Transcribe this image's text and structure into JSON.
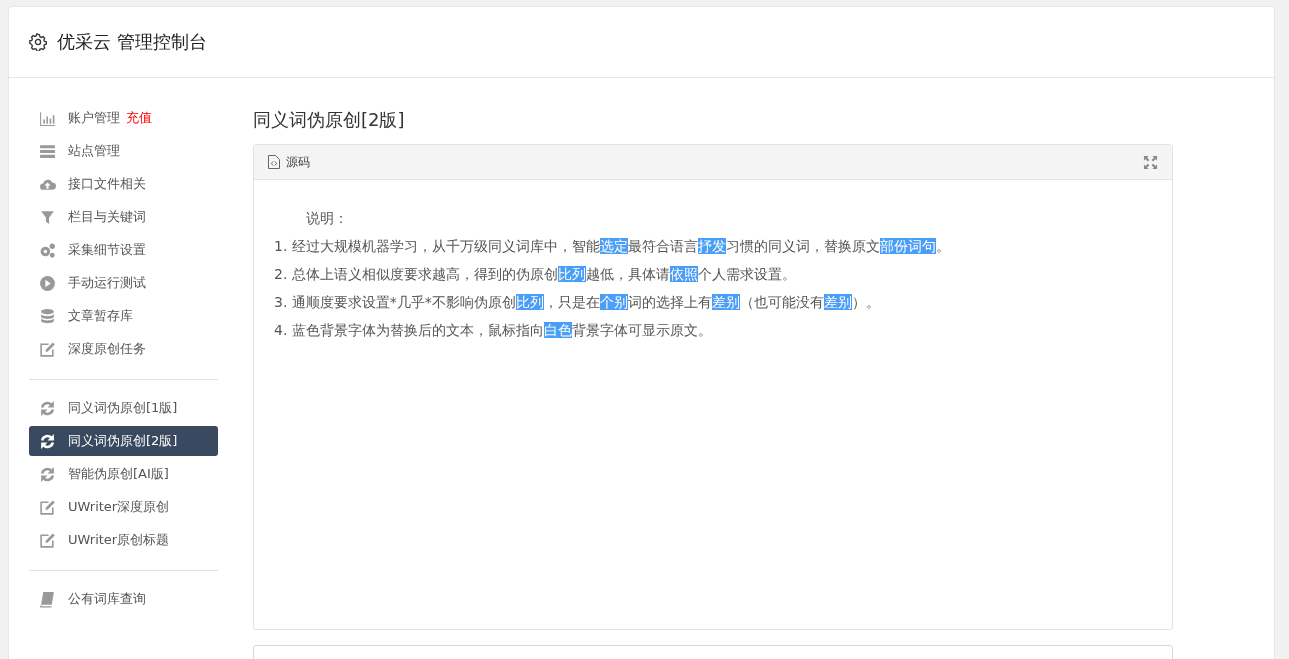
{
  "header": {
    "title": "优采云 管理控制台"
  },
  "sidebar": {
    "groups": [
      {
        "items": [
          {
            "label": "账户管理",
            "badge": "充值",
            "selected": false
          },
          {
            "label": "站点管理",
            "selected": false
          },
          {
            "label": "接口文件相关",
            "selected": false
          },
          {
            "label": "栏目与关键词",
            "selected": false
          },
          {
            "label": "采集细节设置",
            "selected": false
          },
          {
            "label": "手动运行测试",
            "selected": false
          },
          {
            "label": "文章暂存库",
            "selected": false
          },
          {
            "label": "深度原创任务",
            "selected": false
          }
        ]
      },
      {
        "items": [
          {
            "label": "同义词伪原创[1版]",
            "selected": false
          },
          {
            "label": "同义词伪原创[2版]",
            "selected": true
          },
          {
            "label": "智能伪原创[AI版]",
            "selected": false
          },
          {
            "label": "UWriter深度原创",
            "selected": false
          },
          {
            "label": "UWriter原创标题",
            "selected": false
          }
        ]
      },
      {
        "items": [
          {
            "label": "公有词库查询",
            "selected": false
          }
        ]
      }
    ]
  },
  "main": {
    "title": "同义词伪原创[2版]",
    "panel": {
      "tab": "源码",
      "heading": "说明：",
      "lines": [
        [
          {
            "text": "1. 经过大规模机器学习，从千万级同义词库中，智能",
            "highlighted": false
          },
          {
            "text": "选定",
            "highlighted": true
          },
          {
            "text": "最符合语言",
            "highlighted": false
          },
          {
            "text": "抒发",
            "highlighted": true
          },
          {
            "text": "习惯的同义词，替换原文",
            "highlighted": false
          },
          {
            "text": "部份",
            "highlighted": true
          },
          {
            "text": "词句",
            "highlighted": true
          },
          {
            "text": "。",
            "highlighted": false
          }
        ],
        [
          {
            "text": "2. 总体上语义相似度要求越高，得到的伪原创",
            "highlighted": false
          },
          {
            "text": "比列",
            "highlighted": true
          },
          {
            "text": "越低，具体请",
            "highlighted": false
          },
          {
            "text": "依照",
            "highlighted": true
          },
          {
            "text": "个人需求设置。",
            "highlighted": false
          }
        ],
        [
          {
            "text": "3. 通顺度要求设置*几乎*不影响伪原创",
            "highlighted": false
          },
          {
            "text": "比列",
            "highlighted": true
          },
          {
            "text": "，只是在",
            "highlighted": false
          },
          {
            "text": "个别",
            "highlighted": true
          },
          {
            "text": "词的选择上有",
            "highlighted": false
          },
          {
            "text": "差别",
            "highlighted": true
          },
          {
            "text": "（也可能没有",
            "highlighted": false
          },
          {
            "text": "差别",
            "highlighted": true
          },
          {
            "text": "）。",
            "highlighted": false
          }
        ],
        [
          {
            "text": "4. 蓝色背景字体为替换后的文本，鼠标指向",
            "highlighted": false
          },
          {
            "text": "白色",
            "highlighted": true
          },
          {
            "text": "背景字体可显示原文。",
            "highlighted": false
          }
        ]
      ]
    }
  }
}
